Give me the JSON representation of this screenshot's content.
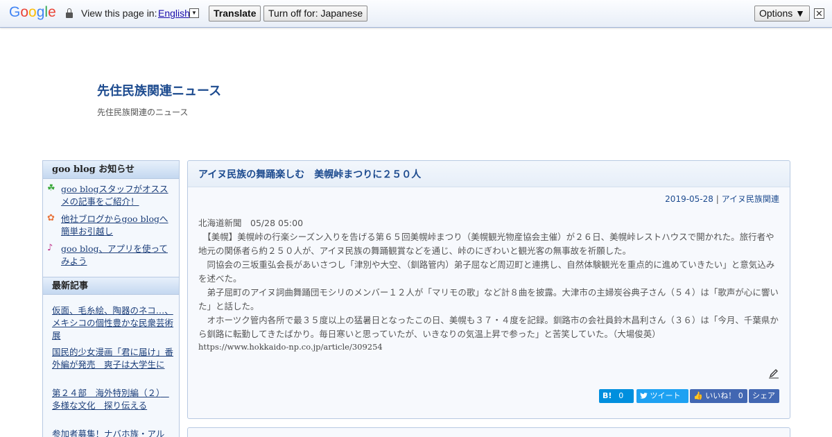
{
  "translate_bar": {
    "logo": [
      "G",
      "o",
      "o",
      "g",
      "l",
      "e"
    ],
    "logo_colors": [
      "#4285f4",
      "#ea4335",
      "#fbbc05",
      "#4285f4",
      "#34a853",
      "#ea4335"
    ],
    "view_text": "View this page in:",
    "language": "English",
    "translate_label": "Translate",
    "turn_off_label": "Turn off for: Japanese",
    "options_label": "Options ▼",
    "close_glyph": "✕"
  },
  "blog": {
    "title": "先住民族関連ニュース",
    "description": "先住民族関連のニュース"
  },
  "sidebar": {
    "notice_heading": "goo blog お知らせ",
    "notices": [
      {
        "icon": "clover-icon",
        "glyph": "☘",
        "color": "#3aa83a",
        "label": "goo blogスタッフがオススメの記事をご紹介！"
      },
      {
        "icon": "flower-icon",
        "glyph": "✿",
        "color": "#e8743c",
        "label": "他社ブログからgoo blogへ簡単お引越し"
      },
      {
        "icon": "music-note-icon",
        "glyph": "♪",
        "color": "#c0338a",
        "label": "goo blog、アプリを使ってみよう"
      }
    ],
    "recent_heading": "最新記事",
    "recent": [
      "仮面、毛糸絵、陶器のネコ…、メキシコの個性豊かな民衆芸術展",
      "国民的少女漫画「君に届け」番外編が発売　爽子は大学生に",
      "第２４部　海外特別編（２）　多様な文化　探り伝える",
      "参加者募集！ナバホ族・アル"
    ]
  },
  "article": {
    "title": "アイヌ民族の舞踊楽しむ　美幌峠まつりに２５０人",
    "date": "2019-05-28",
    "separator": " | ",
    "category": "アイヌ民族関連",
    "paragraphs": [
      "北海道新聞　05/28 05:00",
      "　【美幌】美幌峠の行楽シーズン入りを告げる第６５回美幌峠まつり（美幌観光物産協会主催）が２６日、美幌峠レストハウスで開かれた。旅行者や地元の関係者ら約２５０人が、アイヌ民族の舞踊観賞などを通じ、峠のにぎわいと観光客の無事故を祈願した。",
      "　同協会の三坂重弘会長があいさつし「津別や大空、（釧路管内）弟子屈など周辺町と連携し、自然体験観光を重点的に進めていきたい」と意気込みを述べた。",
      "　弟子屈町のアイヌ詞曲舞踊団モシリのメンバー１２人が「マリモの歌」など計８曲を披露。大津市の主婦炭谷典子さん（５４）は「歌声が心に響いた」と話した。",
      "　オホーツク管内各所で最３５度以上の猛暑日となったこの日、美幌も３７・４度を記録。釧路市の会社員鈴木昌利さん（３６）は「今月、千葉県から釧路に転勤してきたばかり。毎日寒いと思っていたが、いきなりの気温上昇で参った」と苦笑していた。（大場俊英）"
    ],
    "source_url": "https://www.hokkaido-np.co.jp/article/309254",
    "share": {
      "hatena_label": "B!",
      "hatena_count": "0",
      "tweet_label": "ツイート",
      "like_label": "いいね！",
      "like_count": "0",
      "share_label": "シェア"
    }
  }
}
